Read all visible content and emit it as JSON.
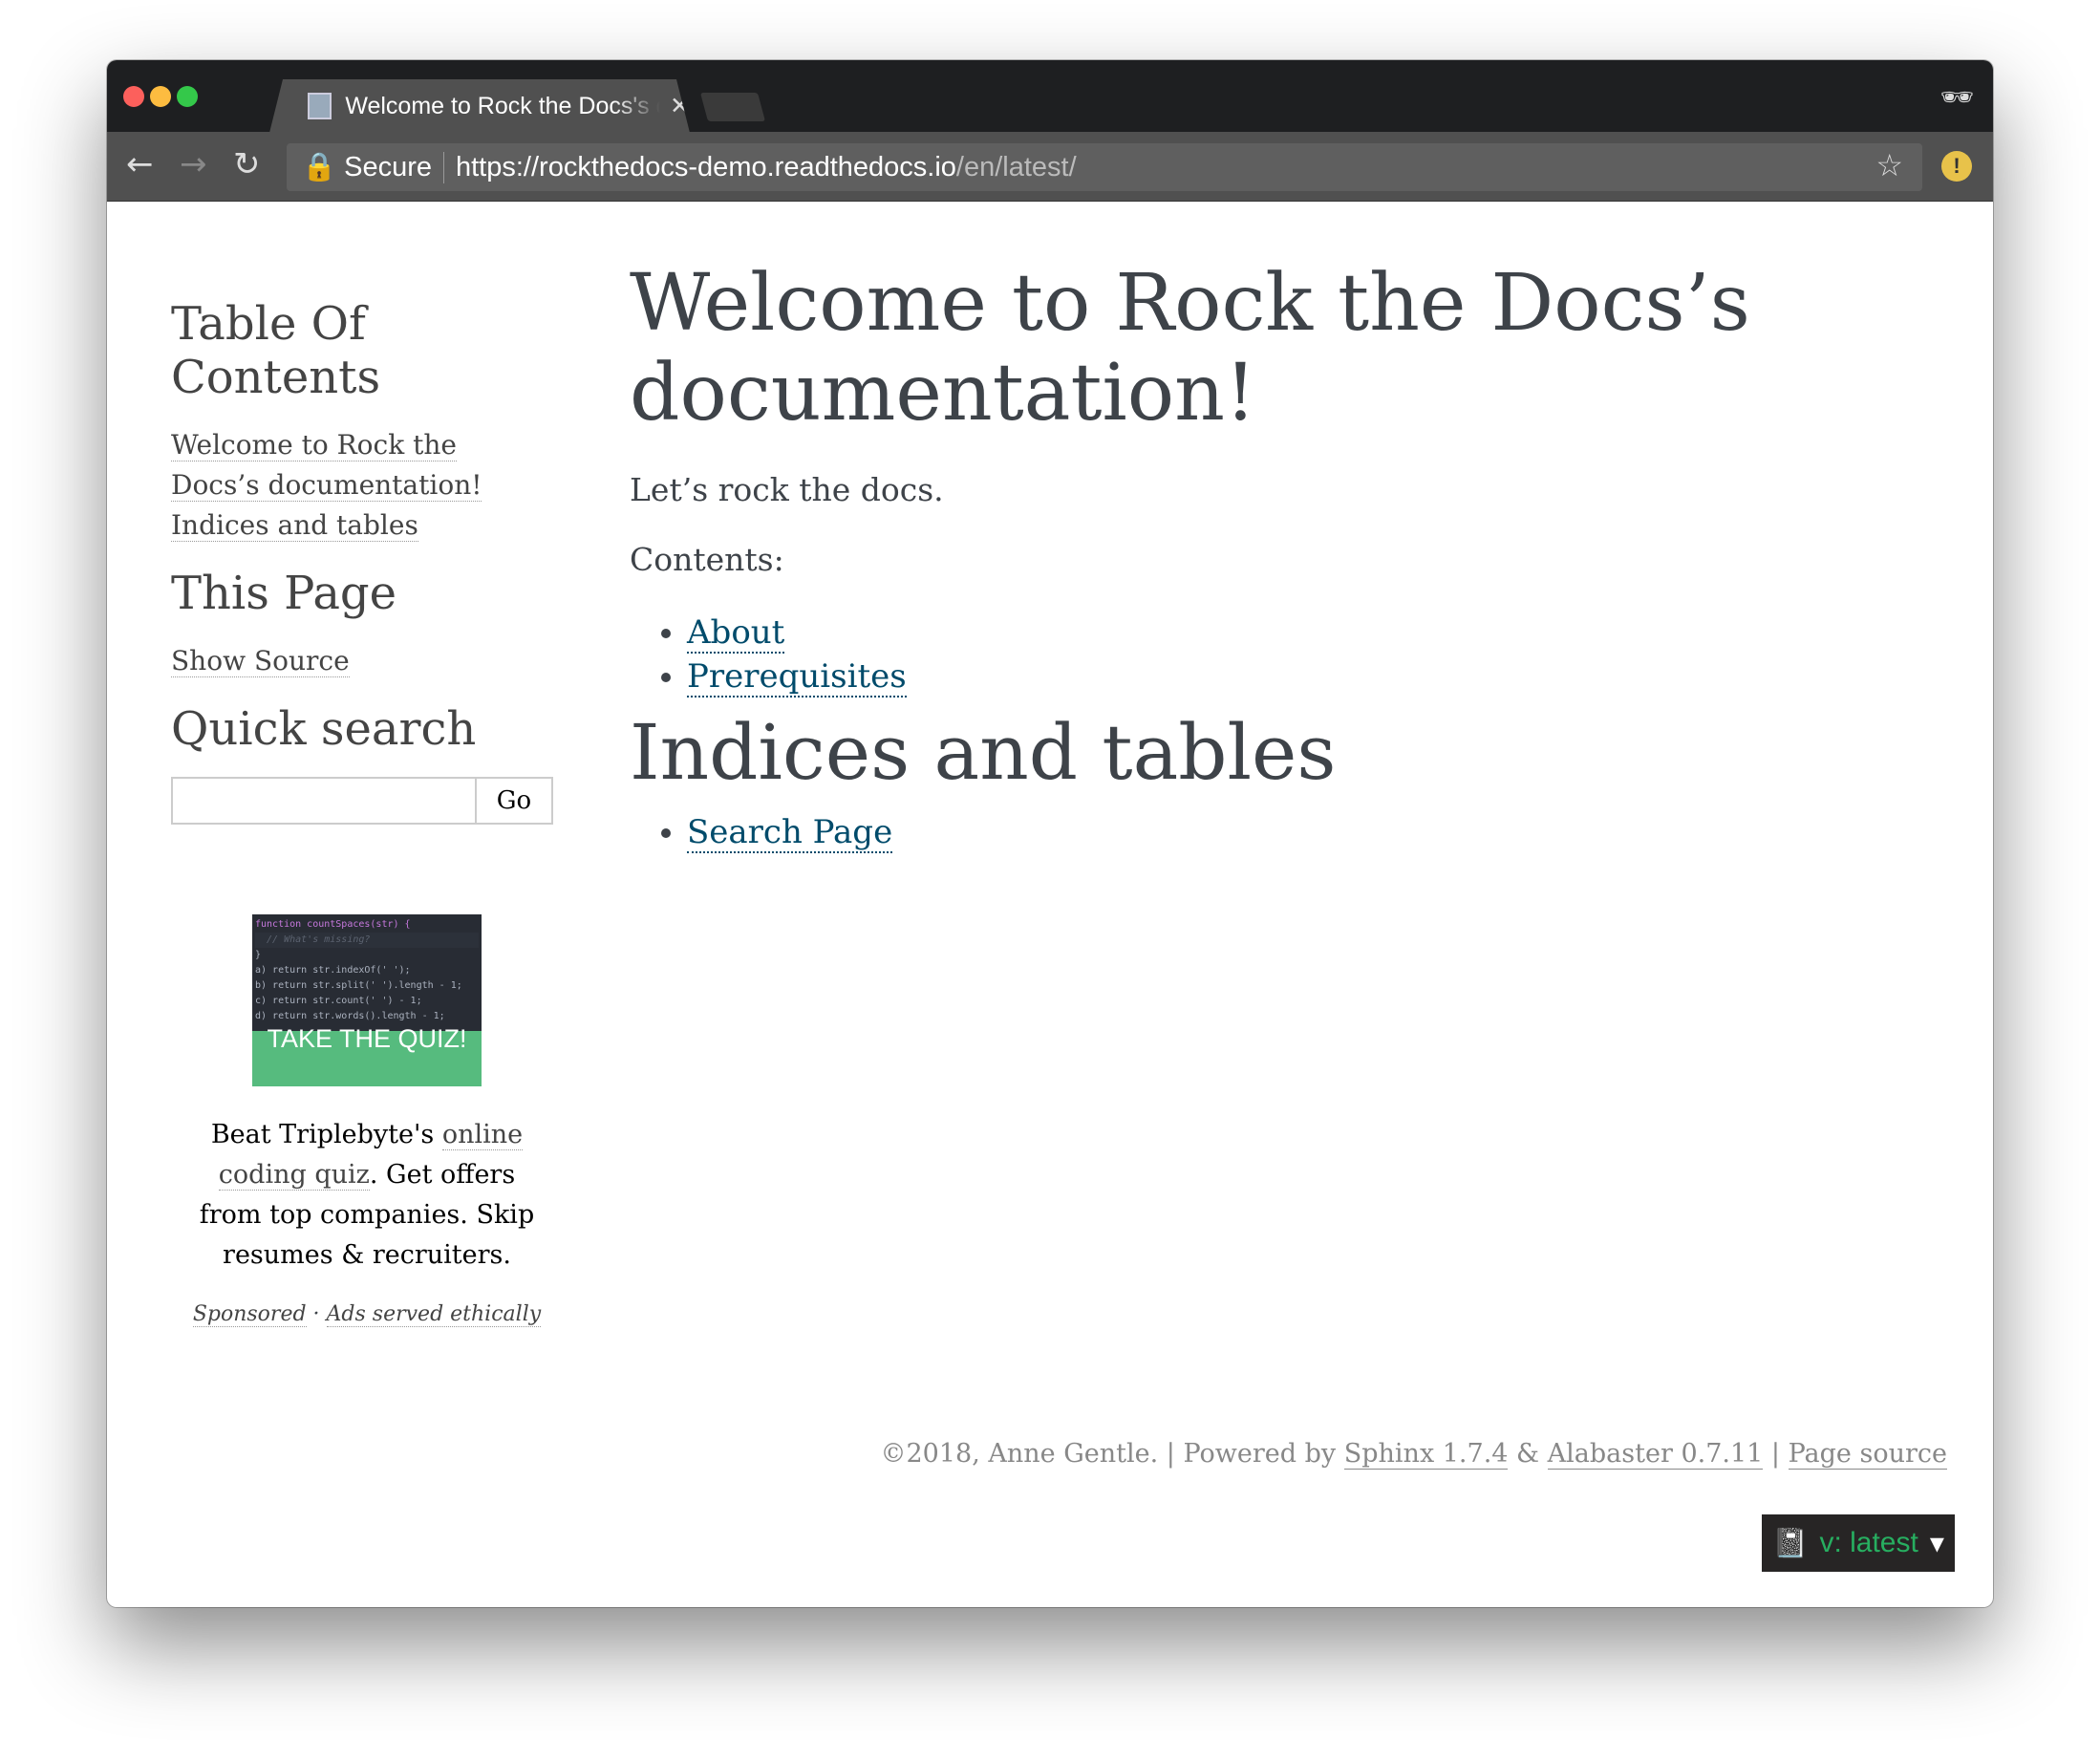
{
  "browser": {
    "tab_title": "Welcome to Rock the Docs's documentation!",
    "secure_label": "Secure",
    "url_host": "https://rockthedocs-demo.readthedocs.io",
    "url_path": "/en/latest/"
  },
  "sidebar": {
    "toc_heading": "Table Of Contents",
    "toc_items": [
      "Welcome to Rock the Docs’s documentation!",
      "Indices and tables"
    ],
    "this_page_heading": "This Page",
    "show_source": "Show Source",
    "search_heading": "Quick search",
    "search_value": "",
    "go_label": "Go"
  },
  "ad": {
    "code_lines": [
      "function countSpaces(str) {",
      "  // What's missing?",
      "}",
      "a) return str.indexOf(' ');",
      "b) return str.split(' ').length - 1;",
      "c) return str.count(' ') - 1;",
      "d) return str.words().length - 1;"
    ],
    "cta": "TAKE THE QUIZ!",
    "text_pre": "Beat Triplebyte's ",
    "link": "online coding quiz",
    "text_post": ". Get offers from top companies. Skip resumes & recruiters.",
    "sponsored": "Sponsored",
    "sep": " · ",
    "ethical": "Ads served ethically"
  },
  "main": {
    "title": "Welcome to Rock the Docs’s documentation!",
    "intro": "Let’s rock the docs.",
    "contents_label": "Contents:",
    "contents": [
      "About",
      "Prerequisites"
    ],
    "indices_heading": "Indices and tables",
    "indices": [
      "Search Page"
    ]
  },
  "footer": {
    "copyright": "©2018, Anne Gentle.",
    "powered": " | Powered by ",
    "sphinx": "Sphinx 1.7.4",
    "amp": " & ",
    "alabaster": "Alabaster 0.7.11",
    "sep": " | ",
    "page_source": "Page source"
  },
  "version": {
    "label": "v: latest"
  }
}
